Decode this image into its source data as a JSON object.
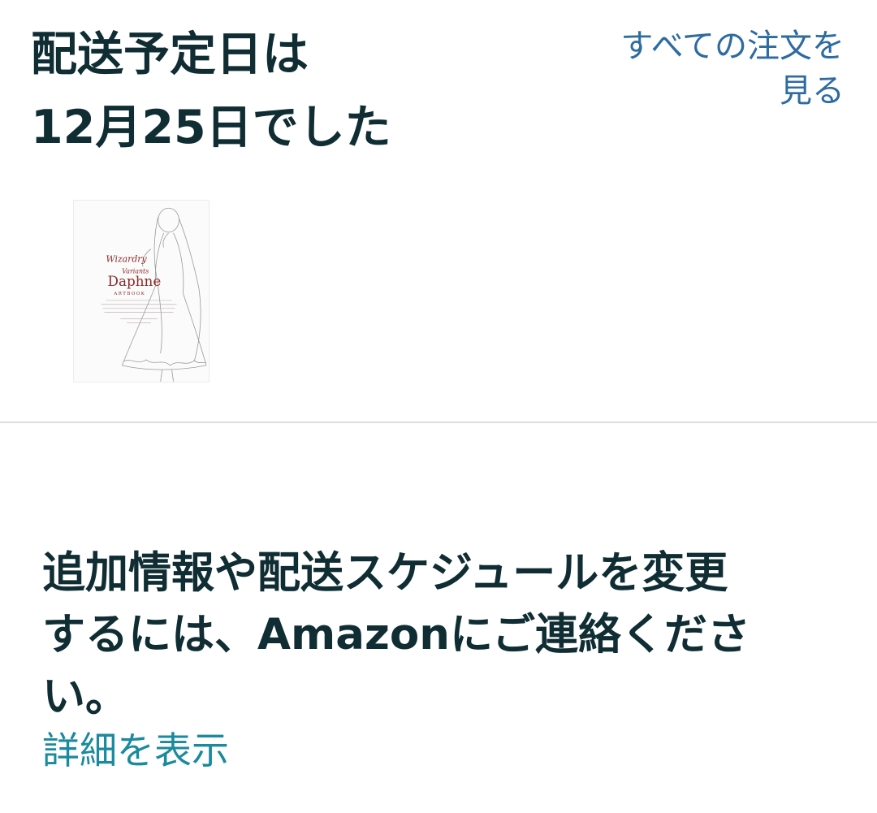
{
  "delivery": {
    "title_line1": "配送予定日は",
    "title_line2": "12月25日でした"
  },
  "header_link": {
    "line1": "すべての注文を",
    "line2": "見る"
  },
  "product": {
    "cover_word": "Daphne",
    "cover_subtitle": "ARTBOOK"
  },
  "contact": {
    "line1": "追加情報や配送スケジュールを変更",
    "line2": "するには、Amazonにご連絡くださ",
    "line3": "い。"
  },
  "details_link": {
    "label": "詳細を表示"
  },
  "colors": {
    "heading": "#0f2d33",
    "link_blue": "#2d6ba1",
    "link_teal": "#1a8a9e",
    "divider": "#dcdcdc",
    "cover_title": "#8b2a2a"
  }
}
